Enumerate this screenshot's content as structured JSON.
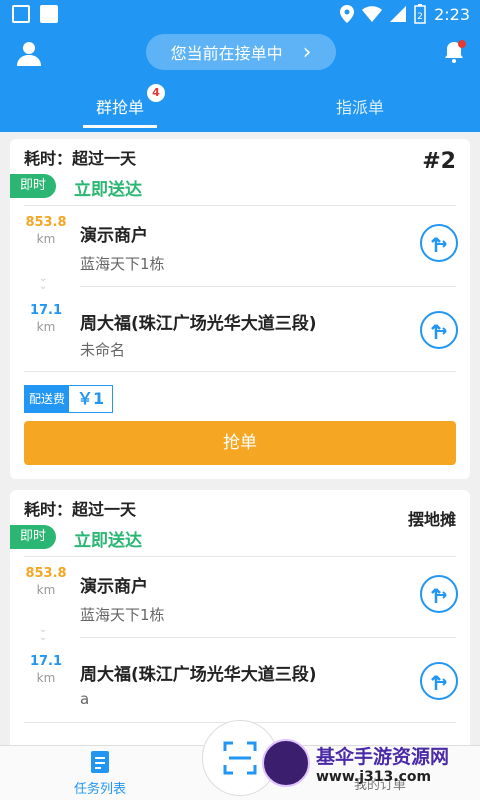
{
  "status_bar": {
    "time": "2:23",
    "battery": "2"
  },
  "header": {
    "status_pill": "您当前在接单中",
    "chevron": "›"
  },
  "tabs": [
    {
      "label": "群抢单",
      "badge": "4",
      "active": true
    },
    {
      "label": "指派单",
      "active": false
    }
  ],
  "orders": [
    {
      "time_label": "耗时：超过一天",
      "corner": "#2",
      "tag": "即时",
      "delivery": "立即送达",
      "pickup": {
        "distance": "853.8",
        "unit": "km",
        "name": "演示商户",
        "address": "蓝海天下1栋"
      },
      "dropoff": {
        "distance": "17.1",
        "unit": "km",
        "name": "周大福(珠江广场光华大道三段)",
        "address": "未命名"
      },
      "fee_label": "配送费",
      "fee_value": "￥1",
      "grab_label": "抢单"
    },
    {
      "time_label": "耗时：超过一天",
      "corner": "摆地摊",
      "tag": "即时",
      "delivery": "立即送达",
      "pickup": {
        "distance": "853.8",
        "unit": "km",
        "name": "演示商户",
        "address": "蓝海天下1栋"
      },
      "dropoff": {
        "distance": "17.1",
        "unit": "km",
        "name": "周大福(珠江广场光华大道三段)",
        "address": "a"
      }
    }
  ],
  "bottom_nav": {
    "left": "任务列表",
    "right": "我的订单"
  },
  "watermark": {
    "title": "基伞手游资源网",
    "url": "www.j313.com"
  },
  "colors": {
    "primary": "#2196f3",
    "accent": "#f5a623",
    "green": "#2bb673"
  },
  "icons": [
    "gallery-icon",
    "square-icon",
    "location-icon",
    "wifi-icon",
    "signal-icon",
    "battery-icon",
    "avatar-icon",
    "bell-icon",
    "navigate-icon",
    "scan-icon",
    "task-list-icon"
  ]
}
